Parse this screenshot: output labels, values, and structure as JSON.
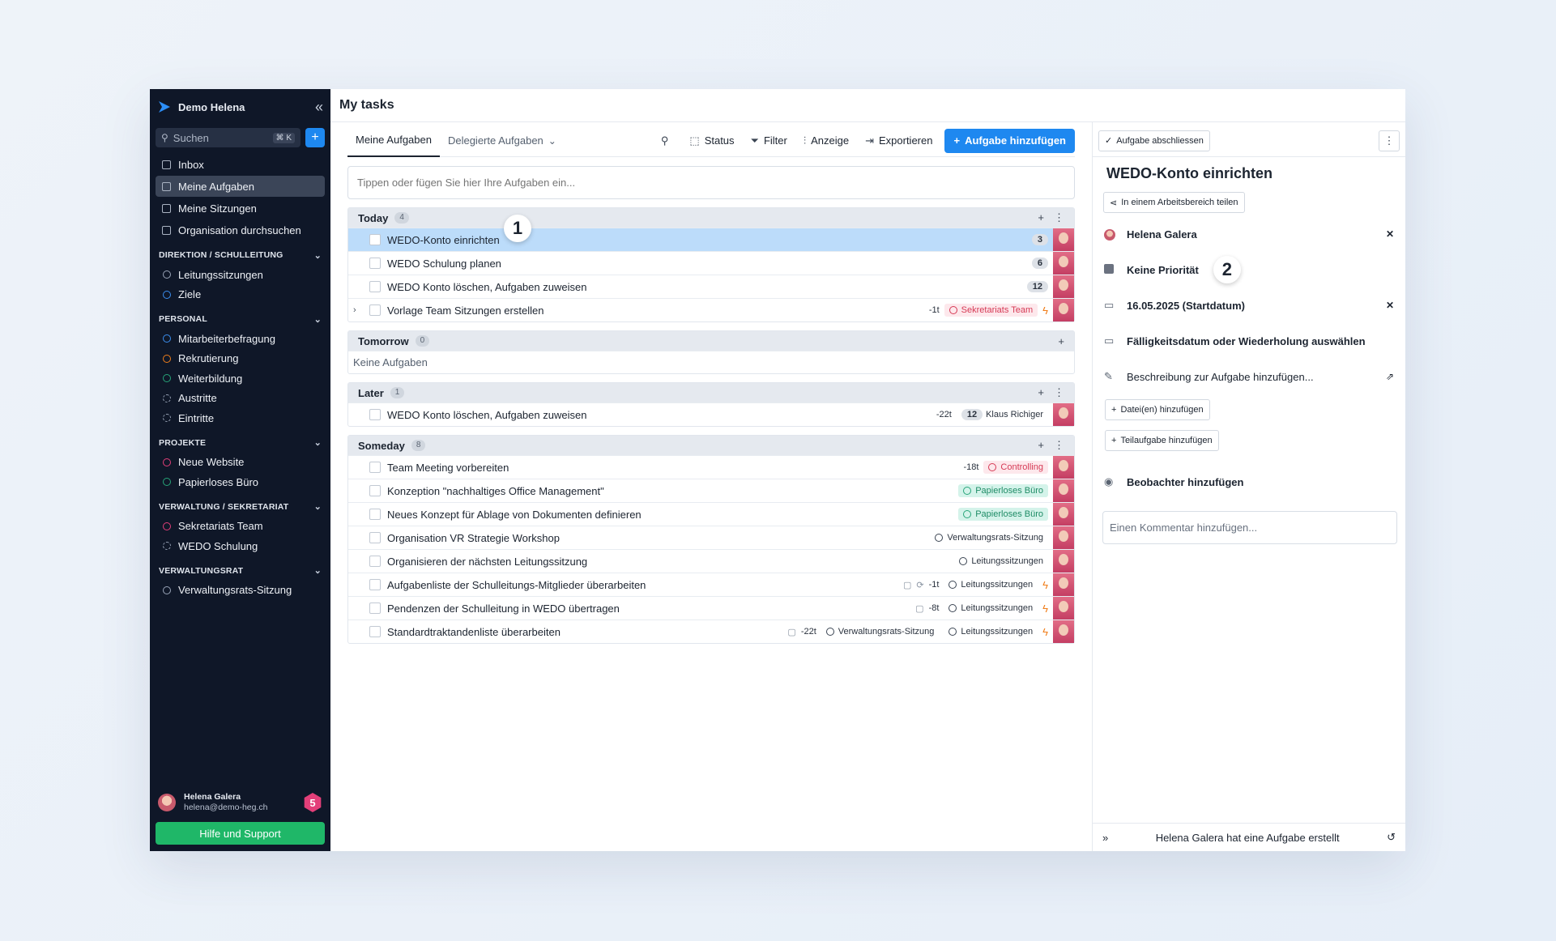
{
  "sidebar": {
    "workspace": "Demo Helena",
    "search": {
      "placeholder": "Suchen",
      "shortcut": "⌘ K"
    },
    "nav": [
      {
        "label": "Inbox"
      },
      {
        "label": "Meine Aufgaben",
        "active": true
      },
      {
        "label": "Meine Sitzungen"
      },
      {
        "label": "Organisation durchsuchen"
      }
    ],
    "groups": [
      {
        "title": "DIREKTION / SCHULLEITUNG",
        "items": [
          {
            "label": "Leitungssitzungen",
            "color": "#9aa5b8"
          },
          {
            "label": "Ziele",
            "color": "#3b8ff0"
          }
        ]
      },
      {
        "title": "PERSONAL",
        "items": [
          {
            "label": "Mitarbeiterbefragung",
            "color": "#3b8ff0"
          },
          {
            "label": "Rekrutierung",
            "color": "#f07e1a"
          },
          {
            "label": "Weiterbildung",
            "color": "#27a579"
          },
          {
            "label": "Austritte",
            "color": "#9aa5b8",
            "dashed": true
          },
          {
            "label": "Eintritte",
            "color": "#9aa5b8",
            "dashed": true
          }
        ]
      },
      {
        "title": "PROJEKTE",
        "items": [
          {
            "label": "Neue Website",
            "color": "#e33f79"
          },
          {
            "label": "Papierloses Büro",
            "color": "#27a579"
          }
        ]
      },
      {
        "title": "VERWALTUNG / SEKRETARIAT",
        "items": [
          {
            "label": "Sekretariats Team",
            "color": "#e33f79"
          },
          {
            "label": "WEDO Schulung",
            "color": "#9aa5b8",
            "dashed": true
          }
        ]
      },
      {
        "title": "VERWALTUNGSRAT",
        "items": [
          {
            "label": "Verwaltungsrats-Sitzung",
            "color": "#9aa5b8"
          }
        ]
      }
    ],
    "user": {
      "name": "Helena Galera",
      "email": "helena@demo-heg.ch",
      "badge": "5"
    },
    "help": "Hilfe und Support"
  },
  "header": {
    "title": "My tasks"
  },
  "tabs": [
    {
      "label": "Meine Aufgaben",
      "active": true
    },
    {
      "label": "Delegierte Aufgaben"
    }
  ],
  "toolbar": {
    "status": "Status",
    "filter": "Filter",
    "display": "Anzeige",
    "export": "Exportieren",
    "add": "Aufgabe hinzufügen"
  },
  "quick_add": {
    "placeholder": "Tippen oder fügen Sie hier Ihre Aufgaben ein..."
  },
  "sections": [
    {
      "title": "Today",
      "count": "4",
      "tasks": [
        {
          "name": "WEDO-Konto einrichten",
          "selected": true,
          "num": "3"
        },
        {
          "name": "WEDO Schulung planen",
          "num": "6"
        },
        {
          "name": "WEDO Konto löschen, Aufgaben zuweisen",
          "num": "12"
        },
        {
          "name": "Vorlage Team Sitzungen erstellen",
          "expandable": true,
          "days": "-1t",
          "tags": [
            {
              "label": "Sekretariats Team",
              "style": "red"
            }
          ],
          "flash": true
        }
      ]
    },
    {
      "title": "Tomorrow",
      "count": "0",
      "empty": "Keine Aufgaben",
      "tasks": []
    },
    {
      "title": "Later",
      "count": "1",
      "tasks": [
        {
          "name": "WEDO Konto löschen, Aufgaben zuweisen",
          "days": "-22t",
          "num_label": "12",
          "person": "Klaus Richiger"
        }
      ]
    },
    {
      "title": "Someday",
      "count": "8",
      "tasks": [
        {
          "name": "Team Meeting vorbereiten",
          "days": "-18t",
          "tags": [
            {
              "label": "Controlling",
              "style": "red"
            }
          ]
        },
        {
          "name": "Konzeption \"nachhaltiges Office Management\"",
          "tags": [
            {
              "label": "Papierloses Büro",
              "style": "green"
            }
          ]
        },
        {
          "name": "Neues Konzept für Ablage von Dokumenten definieren",
          "tags": [
            {
              "label": "Papierloses Büro",
              "style": "green"
            }
          ]
        },
        {
          "name": "Organisation VR Strategie Workshop",
          "tags": [
            {
              "label": "Verwaltungsrats-Sitzung",
              "style": "grey"
            }
          ]
        },
        {
          "name": "Organisieren der nächsten Leitungssitzung",
          "tags": [
            {
              "label": "Leitungssitzungen",
              "style": "grey"
            }
          ]
        },
        {
          "name": "Aufgabenliste der Schulleitungs-Mitglieder überarbeiten",
          "comment": true,
          "repeat": true,
          "days": "-1t",
          "tags": [
            {
              "label": "Leitungssitzungen",
              "style": "grey"
            }
          ],
          "flash": true
        },
        {
          "name": "Pendenzen der Schulleitung in WEDO übertragen",
          "comment": true,
          "days": "-8t",
          "tags": [
            {
              "label": "Leitungssitzungen",
              "style": "grey"
            }
          ],
          "flash": true
        },
        {
          "name": "Standardtraktandenliste überarbeiten",
          "comment": true,
          "days": "-22t",
          "tags": [
            {
              "label": "Verwaltungsrats-Sitzung",
              "style": "grey"
            },
            {
              "label": "Leitungssitzungen",
              "style": "grey"
            }
          ],
          "flash": true
        }
      ]
    }
  ],
  "callouts": {
    "one": "1",
    "two": "2"
  },
  "detail": {
    "complete_btn": "Aufgabe abschliessen",
    "title": "WEDO-Konto einrichten",
    "share": "In einem Arbeitsbereich teilen",
    "assignee": "Helena Galera",
    "priority": "Keine Priorität",
    "start": "16.05.2025  (Startdatum)",
    "due": "Fälligkeitsdatum oder Wiederholung auswählen",
    "description": "Beschreibung zur Aufgabe hinzufügen...",
    "add_files": "Datei(en) hinzufügen",
    "add_subtask": "Teilaufgabe hinzufügen",
    "watchers": "Beobachter hinzufügen",
    "comment_placeholder": "Einen Kommentar hinzufügen...",
    "footer": "Helena Galera hat eine Aufgabe erstellt"
  }
}
